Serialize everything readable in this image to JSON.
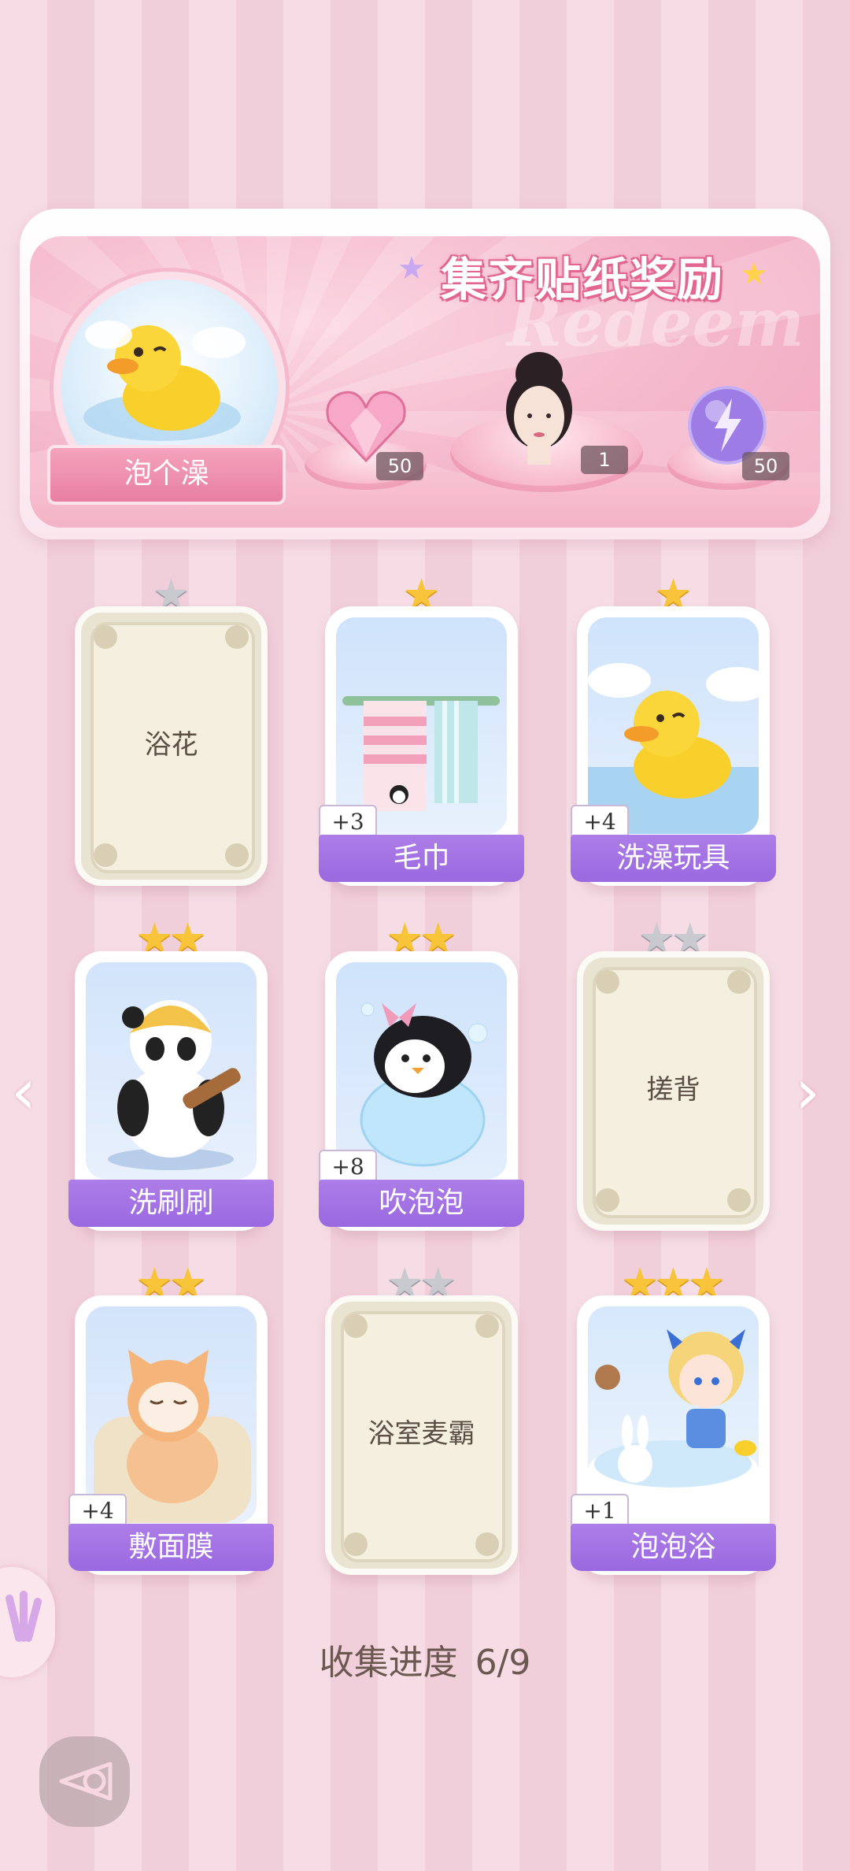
{
  "banner": {
    "title": "集齐贴纸奖励",
    "watermark": "Redeem",
    "bath_label": "泡个澡",
    "rewards": [
      {
        "icon": "pink-diamond-heart-icon",
        "count": "50"
      },
      {
        "icon": "avatar-head-icon",
        "count": "1"
      },
      {
        "icon": "energy-orb-icon",
        "count": "50"
      }
    ]
  },
  "cards": [
    {
      "name": "浴花",
      "stars": 1,
      "collected": false
    },
    {
      "name": "毛巾",
      "stars": 1,
      "collected": true,
      "plus": "+3"
    },
    {
      "name": "洗澡玩具",
      "stars": 1,
      "collected": true,
      "plus": "+4"
    },
    {
      "name": "洗刷刷",
      "stars": 2,
      "collected": true
    },
    {
      "name": "吹泡泡",
      "stars": 2,
      "collected": true,
      "plus": "+8"
    },
    {
      "name": "搓背",
      "stars": 2,
      "collected": false
    },
    {
      "name": "敷面膜",
      "stars": 2,
      "collected": true,
      "plus": "+4"
    },
    {
      "name": "浴室麦霸",
      "stars": 2,
      "collected": false
    },
    {
      "name": "泡泡浴",
      "stars": 3,
      "collected": true,
      "plus": "+1"
    }
  ],
  "progress": {
    "label": "收集进度",
    "value": "6/9"
  },
  "colors": {
    "accent_purple": "#9a68e0",
    "banner_pink": "#f4b7cb",
    "star_gold": "#f8c43a",
    "star_silver": "#c9c9d0"
  }
}
